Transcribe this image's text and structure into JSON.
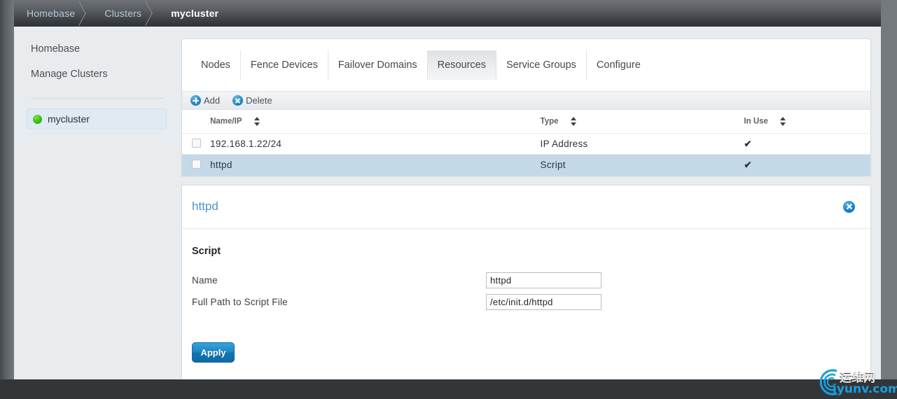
{
  "breadcrumb": {
    "items": [
      {
        "label": "Homebase",
        "current": false
      },
      {
        "label": "Clusters",
        "current": false
      },
      {
        "label": "mycluster",
        "current": true
      }
    ]
  },
  "sidebar": {
    "links": [
      {
        "label": "Homebase"
      },
      {
        "label": "Manage Clusters"
      }
    ],
    "clusters": [
      {
        "label": "mycluster",
        "status_color": "#38bf12",
        "selected": true
      }
    ]
  },
  "tabs": [
    {
      "label": "Nodes",
      "active": false
    },
    {
      "label": "Fence Devices",
      "active": false
    },
    {
      "label": "Failover Domains",
      "active": false
    },
    {
      "label": "Resources",
      "active": true
    },
    {
      "label": "Service Groups",
      "active": false
    },
    {
      "label": "Configure",
      "active": false
    }
  ],
  "toolbar": {
    "add_label": "Add",
    "delete_label": "Delete",
    "add_icon": "plus-circle-icon",
    "delete_icon": "x-circle-icon"
  },
  "table": {
    "columns": [
      "Name/IP",
      "Type",
      "In Use"
    ],
    "rows": [
      {
        "name": "192.168.1.22/24",
        "type": "IP Address",
        "in_use": "✔",
        "checked": false,
        "highlighted": false
      },
      {
        "name": "httpd",
        "type": "Script",
        "in_use": "✔",
        "checked": false,
        "highlighted": true
      }
    ]
  },
  "detail": {
    "title": "httpd",
    "close_icon": "close-circle-icon",
    "section_title": "Script",
    "fields": [
      {
        "label": "Name",
        "value": "httpd"
      },
      {
        "label": "Full Path to Script File",
        "value": "/etc/init.d/httpd"
      }
    ],
    "apply_label": "Apply"
  },
  "watermark": {
    "cn": "运维网",
    "url": "iyunv.com",
    "accent": "#1a9ee0"
  }
}
